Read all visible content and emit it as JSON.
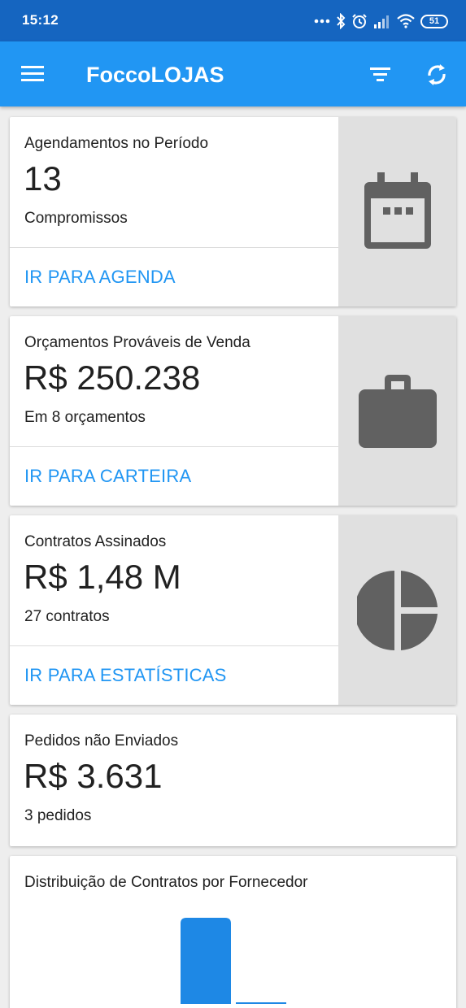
{
  "status": {
    "time": "15:12",
    "battery": "51"
  },
  "appbar": {
    "title": "FoccoLOJAS"
  },
  "cards": [
    {
      "label": "Agendamentos no Período",
      "value": "13",
      "sub": "Compromissos",
      "action": "IR PARA AGENDA",
      "icon": "calendar-icon"
    },
    {
      "label": "Orçamentos Prováveis de Venda",
      "value": "R$ 250.238",
      "sub": "Em 8 orçamentos",
      "action": "IR PARA CARTEIRA",
      "icon": "briefcase-icon"
    },
    {
      "label": "Contratos Assinados",
      "value": "R$ 1,48 M",
      "sub": "27 contratos",
      "action": "IR PARA ESTATÍSTICAS",
      "icon": "pie-chart-icon"
    },
    {
      "label": "Pedidos não Enviados",
      "value": "R$ 3.631",
      "sub": "3 pedidos"
    }
  ],
  "distribution": {
    "title": "Distribuição de Contratos por Fornecedor",
    "bar_color": "#1e88e5"
  },
  "colors": {
    "primary": "#2196f3",
    "primary_dark": "#1565c0",
    "icon_gray": "#616161"
  }
}
